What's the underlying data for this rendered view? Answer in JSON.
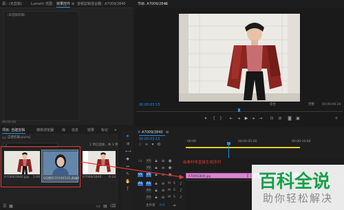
{
  "source_panel": {
    "tabs": [
      "源：(无剪辑)",
      "Lumetri 范围",
      "效果控件",
      "音频剪辑混合器：A7009/2840"
    ],
    "active_tab": 2,
    "menu_icon": "≡",
    "placeholder": "（未选择剪辑）",
    "timecode": "00:00:00"
  },
  "program_monitor": {
    "title": "节目: A7009/2840",
    "menu_icon": "≡",
    "timecode_left": "00:00:03:15",
    "fit_label": "适合",
    "quality_label": "完整",
    "timecode_right": "00:00:06:24"
  },
  "project_panel": {
    "tabs": [
      "项目: 自建剪辑",
      "媒体浏览器",
      "库",
      "信息",
      "效果",
      "标记"
    ],
    "active_tab": 0,
    "more_icon": "»",
    "project_file": "自建剪辑.prproj",
    "selection_info": "1 项已选择，共 3 项",
    "clips": [
      {
        "name": "A7009/2840.jpg",
        "duration": "5:00"
      },
      {
        "name": "QQ图片20190526.png",
        "duration": "5:00"
      },
      {
        "name": "A7009/2840",
        "duration": "6:24"
      }
    ]
  },
  "tools": {
    "icons": [
      "selection-tool-icon",
      "track-select-tool-icon",
      "ripple-edit-tool-icon",
      "razor-tool-icon",
      "slip-tool-icon",
      "pen-tool-icon",
      "hand-tool-icon",
      "type-tool-icon"
    ]
  },
  "timeline": {
    "title": "A7009/2840",
    "menu_icon": "≡",
    "timecode": "00:00:03:15",
    "ruler_labels": [
      "00:00",
      "00:00:05:00",
      "00:00:10:00"
    ],
    "video_tracks": [
      "V3",
      "V2",
      "V1"
    ],
    "audio_tracks": [
      "A1",
      "A2",
      "A3"
    ],
    "master_label": "主声道",
    "master_value": "0.0",
    "clip_label": "A7009/2840.jpg",
    "second_clip_label": "QQ图片2019..."
  },
  "annotation": {
    "text": "由素材来直接生成序列",
    "color": "#e03a2f"
  },
  "watermark": {
    "title": "百科全说",
    "subtitle": "助你轻松解决"
  },
  "colors": {
    "accent_blue": "#2d8ceb",
    "selection_red": "#e03a2f",
    "clip_pink": "#d887d2",
    "work_area_yellow": "#e7d417"
  }
}
